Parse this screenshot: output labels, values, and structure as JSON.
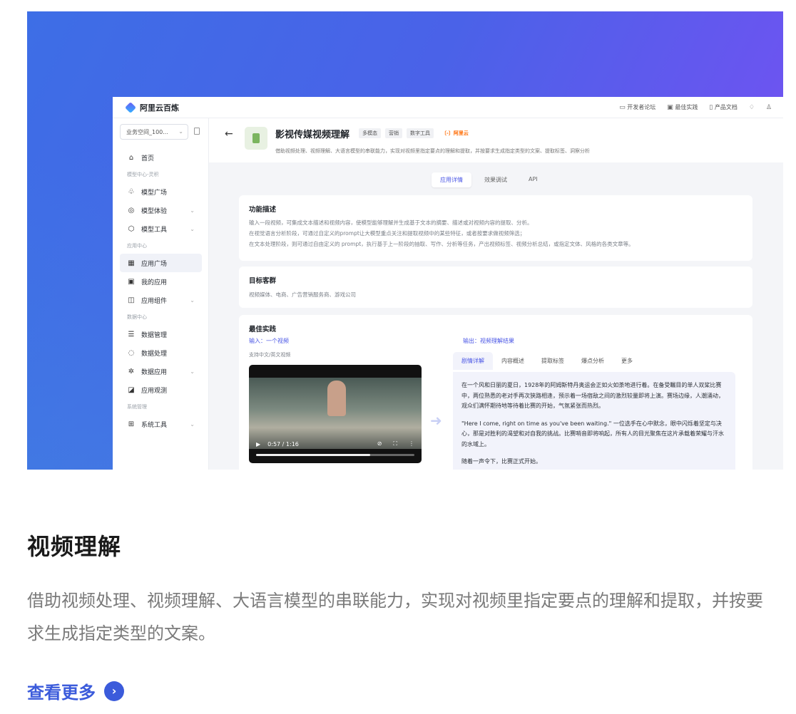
{
  "topbar": {
    "brand": "阿里云百炼",
    "links": [
      "开发者论坛",
      "最佳实践",
      "产品文档"
    ]
  },
  "sidebar": {
    "workspace": "业务空间_100...",
    "items": [
      {
        "type": "item",
        "label": "首页",
        "icon": "⌂"
      },
      {
        "type": "group",
        "label": "模型中心-灵积"
      },
      {
        "type": "item",
        "label": "模型广场",
        "icon": "♧"
      },
      {
        "type": "item",
        "label": "模型体验",
        "icon": "◎",
        "chev": true
      },
      {
        "type": "item",
        "label": "模型工具",
        "icon": "⬡",
        "chev": true
      },
      {
        "type": "group",
        "label": "应用中心"
      },
      {
        "type": "item",
        "label": "应用广场",
        "icon": "▦",
        "active": true
      },
      {
        "type": "item",
        "label": "我的应用",
        "icon": "▣"
      },
      {
        "type": "item",
        "label": "应用组件",
        "icon": "◫",
        "chev": true
      },
      {
        "type": "group",
        "label": "数据中心"
      },
      {
        "type": "item",
        "label": "数据管理",
        "icon": "☰"
      },
      {
        "type": "item",
        "label": "数据处理",
        "icon": "◌"
      },
      {
        "type": "item",
        "label": "数据应用",
        "icon": "✲",
        "chev": true
      },
      {
        "type": "item",
        "label": "应用观测",
        "icon": "◪"
      },
      {
        "type": "group",
        "label": "系统管理"
      },
      {
        "type": "item",
        "label": "系统工具",
        "icon": "⊞",
        "chev": true
      }
    ]
  },
  "app": {
    "title": "影视传媒视频理解",
    "tags": [
      "多模态",
      "营销",
      "数字工具"
    ],
    "vendor": "〔-〕阿里云",
    "desc": "借助视频处理、视频理解、大语言模型的串联能力，实现对视频里指定要点的理解和提取，并按要求生成指定类型的文案、提取标签、洞察分析"
  },
  "tabs": [
    "应用详情",
    "效果调试",
    "API"
  ],
  "feature": {
    "title": "功能描述",
    "lines": [
      "输入一段视频，可集成文本描述和视频内容，使模型能够理解并生成基于文本的摘要、描述或对视频内容的提取、分析。",
      "在视觉语言分析阶段，可通过自定义的prompt让大模型重点关注和提取视频中的某些特征，或者按要求做视频筛选；",
      "在文本处理阶段，则可通过自由定义的 prompt，执行基于上一阶段的抽取、写作、分析等任务，产出视频标签、视频分析总结，或指定文体、风格的各类文章等。"
    ]
  },
  "audience": {
    "title": "目标客群",
    "text": "视频媒体、电商、广告营销服务商、游戏公司"
  },
  "practice": {
    "title": "最佳实践",
    "input_label": "输入：一个视频",
    "input_note": "支持中文/英文视频",
    "output_label": "输出：视频理解结果",
    "video_time": "0:57 / 1:16",
    "video_progress": 0.72,
    "out_tabs": [
      "剧情详解",
      "内容概述",
      "提取标签",
      "爆点分析",
      "更多"
    ],
    "out_paras": [
      "在一个风和日丽的夏日，1928年的阿姆斯特丹奥运会正如火如荼地进行着。在备受瞩目的单人双桨比赛中，两位熟悉的老对手再次狭路相逢，预示着一场宿敌之间的激烈较量即将上演。赛场边缘，人潮涌动，观众们满怀期待地等待着比赛的开始，气氛紧张而热烈。",
      "\"Here I come, right on time as you've been waiting.\" 一位选手在心中默念，眼中闪烁着坚定与决心，那是对胜利的渴望和对自我的挑战。比赛哨音即将响起，所有人的目光聚焦在这片承载着荣耀与汗水的水域上。",
      "随着一声令下，比赛正式开始。"
    ]
  },
  "content": {
    "headline": "视频理解",
    "description": "借助视频处理、视频理解、大语言模型的串联能力，实现对视频里指定要点的理解和提取，并按要求生成指定类型的文案。",
    "more": "查看更多"
  }
}
